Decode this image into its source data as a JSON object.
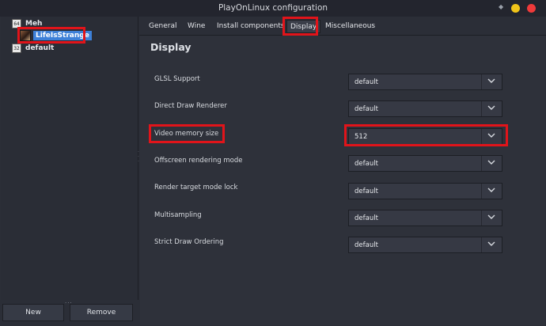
{
  "window": {
    "title": "PlayOnLinux configuration"
  },
  "colors": {
    "min_button": "#f0c419",
    "close_button": "#ef3a3a",
    "highlight": "#e1141a",
    "selection": "#3d80d8"
  },
  "tree": {
    "items": [
      {
        "icon_text": "64",
        "label": "Meh"
      },
      {
        "label": "LifeIsStrange",
        "selected": true
      },
      {
        "icon_text": "32",
        "label": "default"
      }
    ]
  },
  "buttons": {
    "new": "New",
    "remove": "Remove"
  },
  "tabs": [
    "General",
    "Wine",
    "Install components",
    "Display",
    "Miscellaneous"
  ],
  "active_tab": "Display",
  "section_title": "Display",
  "options": [
    {
      "label": "GLSL Support",
      "value": "default"
    },
    {
      "label": "Direct Draw Renderer",
      "value": "default"
    },
    {
      "label": "Video memory size",
      "value": "512"
    },
    {
      "label": "Offscreen rendering mode",
      "value": "default"
    },
    {
      "label": "Render target mode lock",
      "value": "default"
    },
    {
      "label": "Multisampling",
      "value": "default"
    },
    {
      "label": "Strict Draw Ordering",
      "value": "default"
    }
  ]
}
